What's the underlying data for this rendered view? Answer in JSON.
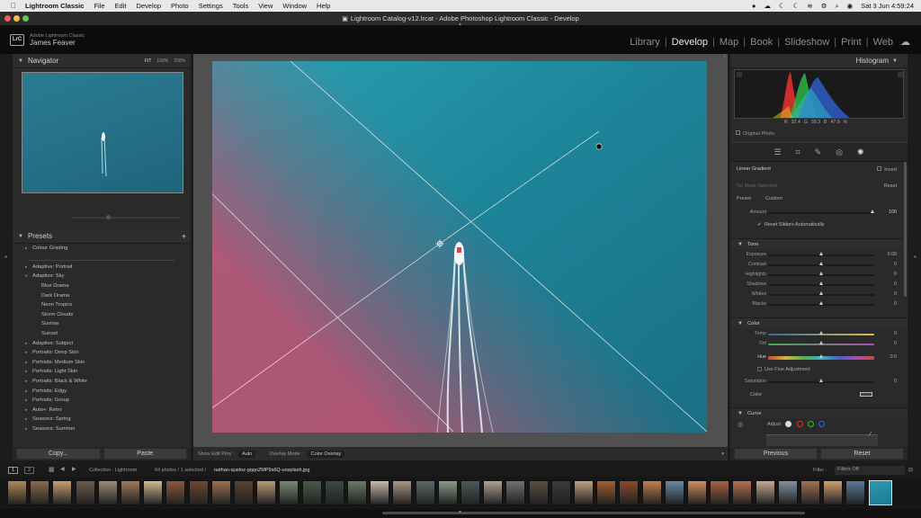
{
  "menubar": {
    "app": "Lightroom Classic",
    "items": [
      "File",
      "Edit",
      "Develop",
      "Photo",
      "Settings",
      "Tools",
      "View",
      "Window",
      "Help"
    ],
    "clock": "Sat 3 Jun  4:59:24"
  },
  "window": {
    "title": "Lightroom Catalog-v12.lrcat - Adobe Photoshop Lightroom Classic - Develop"
  },
  "identity": {
    "logo": "LrC",
    "brand": "Adobe Lightroom Classic",
    "user": "James Feaver"
  },
  "modules": [
    "Library",
    "Develop",
    "Map",
    "Book",
    "Slideshow",
    "Print",
    "Web"
  ],
  "active_module": "Develop",
  "navigator": {
    "title": "Navigator",
    "zoom_options": [
      "FIT",
      "100%",
      "200%"
    ]
  },
  "presets": {
    "title": "Presets",
    "items": [
      {
        "label": "Colour Grading",
        "level": 0,
        "arrow": "▸"
      },
      {
        "label": "",
        "level": 0,
        "arrow": ""
      },
      {
        "label": "Adaptive: Portrait",
        "level": 0,
        "arrow": "▸"
      },
      {
        "label": "Adaptive: Sky",
        "level": 0,
        "arrow": "▾"
      },
      {
        "label": "Blue Drama",
        "level": 1,
        "arrow": ""
      },
      {
        "label": "Dark Drama",
        "level": 1,
        "arrow": ""
      },
      {
        "label": "Neon Tropics",
        "level": 1,
        "arrow": ""
      },
      {
        "label": "Storm Clouds",
        "level": 1,
        "arrow": ""
      },
      {
        "label": "Sunrise",
        "level": 1,
        "arrow": ""
      },
      {
        "label": "Sunset",
        "level": 1,
        "arrow": ""
      },
      {
        "label": "Adaptive: Subject",
        "level": 0,
        "arrow": "▸"
      },
      {
        "label": "Portraits: Deep Skin",
        "level": 0,
        "arrow": "▸"
      },
      {
        "label": "Portraits: Medium Skin",
        "level": 0,
        "arrow": "▸"
      },
      {
        "label": "Portraits: Light Skin",
        "level": 0,
        "arrow": "▸"
      },
      {
        "label": "Portraits: Black & White",
        "level": 0,
        "arrow": "▸"
      },
      {
        "label": "Portraits: Edgy",
        "level": 0,
        "arrow": "▸"
      },
      {
        "label": "Portraits: Group",
        "level": 0,
        "arrow": "▸"
      },
      {
        "label": "Auto+: Retro",
        "level": 0,
        "arrow": "▸"
      },
      {
        "label": "Seasons: Spring",
        "level": 0,
        "arrow": "▸"
      },
      {
        "label": "Seasons: Summer",
        "level": 0,
        "arrow": "▸"
      }
    ]
  },
  "left_buttons": {
    "copy": "Copy...",
    "paste": "Paste"
  },
  "toolbar": {
    "edit_pins_label": "Show Edit Pins :",
    "edit_pins_value": "Auto",
    "overlay_label": "Overlay Mode :",
    "overlay_value": "Color Overlay"
  },
  "histogram": {
    "title": "Histogram",
    "r_label": "R",
    "r_value": "32.4",
    "g_label": "G",
    "g_value": "39.3",
    "b_label": "B",
    "b_value": "47.9",
    "unit": "%",
    "original_photo": "Original Photo"
  },
  "mask": {
    "title": "Linear Gradient",
    "invert": "Invert",
    "no_mask": "No Mask Selected",
    "reset": "Reset",
    "preset_label": "Preset",
    "preset_value": "Custom",
    "amount_label": "Amount",
    "amount_value": "100",
    "amount_level": 0.99,
    "reset_sliders": "Reset Sliders Automatically"
  },
  "tone": {
    "title": "Tone",
    "sliders": [
      {
        "label": "Exposure",
        "value": "0.00",
        "level": 0.5
      },
      {
        "label": "Contrast",
        "value": "0",
        "level": 0.5
      },
      {
        "label": "Highlights",
        "value": "0",
        "level": 0.5
      },
      {
        "label": "Shadows",
        "value": "0",
        "level": 0.5
      },
      {
        "label": "Whites",
        "value": "0",
        "level": 0.5
      },
      {
        "label": "Blacks",
        "value": "0",
        "level": 0.5
      }
    ]
  },
  "color": {
    "title": "Color",
    "temp": {
      "label": "Temp",
      "value": "0",
      "level": 0.5
    },
    "tint": {
      "label": "Tint",
      "value": "0",
      "level": 0.5
    },
    "hue": {
      "label": "Hue",
      "value": "0.0",
      "level": 0.5
    },
    "fine": "Use Fine Adjustment",
    "saturation": {
      "label": "Saturation",
      "value": "0",
      "level": 0.5
    },
    "color_label": "Color"
  },
  "curve": {
    "title": "Curve",
    "adjust": "Adjust"
  },
  "right_buttons": {
    "previous": "Previous",
    "reset": "Reset"
  },
  "filmbar": {
    "page1": "1",
    "page2": "2",
    "collection": "Collection : Lightroom",
    "count": "64 photos / 1 selected /",
    "filename": "nathan-queloz-gqqoZMP9s6Q-unsplash.jpg",
    "filter_label": "Filter :",
    "filter_value": "Filters Off"
  },
  "colors": {
    "accent": "#e8e8e8",
    "panel": "#2a2a2a",
    "water": "#1f7f93",
    "mask_overlay": "#c0506a"
  }
}
